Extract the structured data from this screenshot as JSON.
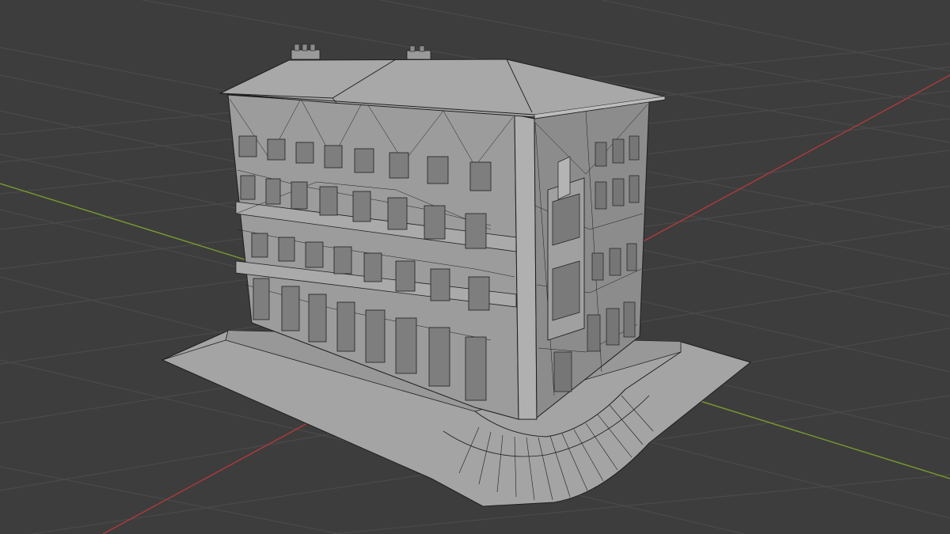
{
  "viewport": {
    "background": "#3d3d3d",
    "grid_color": "#4a4a4a",
    "x_axis_color": "#b03a3a",
    "y_axis_color": "#7a9b2e"
  },
  "model": {
    "roof_color": "#a8a8a8",
    "facade_color": "#9c9c9c",
    "side_color": "#8c8c8c",
    "sidewalk_color": "#a4a4a4",
    "wire_color": "#1e1e1e",
    "chimney_icons": [
      "chimney-icon",
      "chimney-icon"
    ]
  }
}
